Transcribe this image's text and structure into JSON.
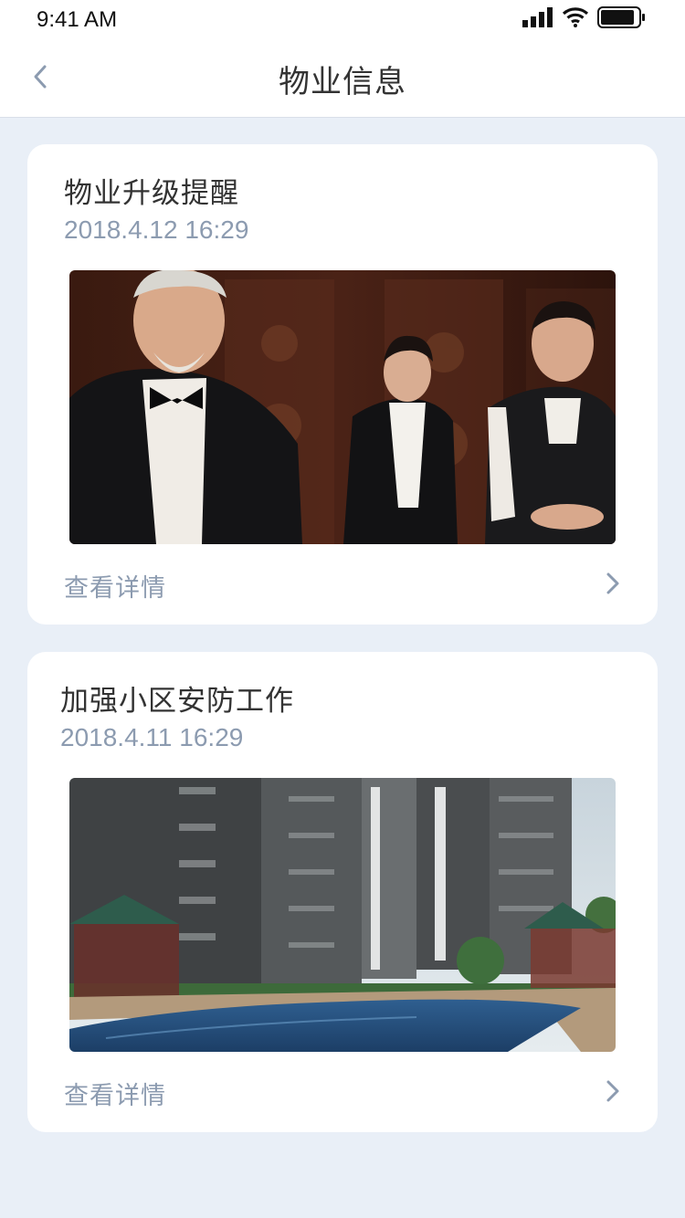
{
  "status_bar": {
    "time": "9:41 AM",
    "icons": [
      "signal-icon",
      "wifi-icon",
      "battery-icon"
    ]
  },
  "nav": {
    "title": "物业信息",
    "back_icon": "chevron-left-icon"
  },
  "cards": [
    {
      "title": "物业升级提醒",
      "date": "2018.4.12 16:29",
      "image": "property-staff-photo",
      "detail_label": "查看详情",
      "detail_icon": "chevron-right-icon"
    },
    {
      "title": "加强小区安防工作",
      "date": "2018.4.11 16:29",
      "image": "residential-complex-pool-photo",
      "detail_label": "查看详情",
      "detail_icon": "chevron-right-icon"
    }
  ],
  "colors": {
    "background": "#e9eff7",
    "title_text": "#333333",
    "secondary_text": "#8c9bb0"
  }
}
